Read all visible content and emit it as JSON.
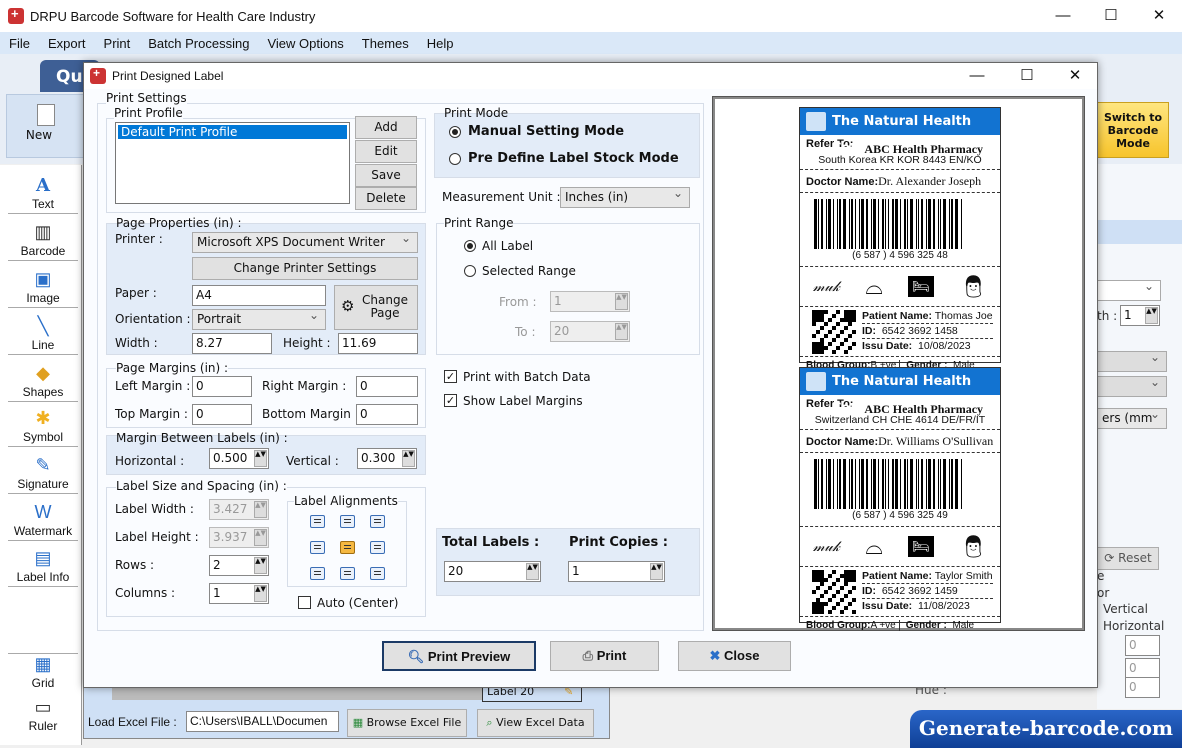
{
  "app": {
    "title": "DRPU Barcode Software for Health Care Industry",
    "window_controls": {
      "minimize": "—",
      "maximize": "☐",
      "close": "✕"
    },
    "menu": [
      "File",
      "Export",
      "Print",
      "Batch Processing",
      "View Options",
      "Themes",
      "Help"
    ],
    "tab": "Qui",
    "new_label": "New",
    "switch_button": "Switch to Barcode Mode",
    "tools": [
      "Text",
      "Barcode",
      "Image",
      "Line",
      "Shapes",
      "Symbol",
      "Signature",
      "Watermark",
      "Label Info"
    ],
    "bottom_tools": [
      "Grid",
      "Ruler"
    ],
    "excel": {
      "label": "Load Excel File :",
      "path": "C:\\Users\\IBALL\\Documen",
      "browse": "Browse Excel File",
      "view": "View Excel Data",
      "label_cell": "Label 20"
    },
    "right_panel": {
      "width_label": "th :",
      "width_value": "1",
      "unit": "ers (mm",
      "reset": "Reset",
      "e": "e",
      "or": "or",
      "vertical": "Vertical",
      "horizontal": "Horizontal",
      "values": [
        "0",
        "0",
        "0"
      ],
      "hue": "Hue :"
    },
    "banner": "Generate-barcode.com"
  },
  "dialog": {
    "title": "Print Designed Label",
    "window_controls": {
      "minimize": "—",
      "maximize": "☐",
      "close": "✕"
    },
    "print_settings": "Print Settings",
    "print_profile": {
      "title": "Print Profile",
      "items": [
        "Default Print Profile"
      ],
      "buttons": [
        "Add",
        "Edit",
        "Save",
        "Delete"
      ]
    },
    "page_properties": {
      "title": "Page Properties (in) :",
      "printer_label": "Printer :",
      "printer": "Microsoft XPS Document Writer",
      "change_printer": "Change Printer Settings",
      "paper_label": "Paper :",
      "paper": "A4",
      "change_page": "Change Page",
      "orientation_label": "Orientation :",
      "orientation": "Portrait",
      "width_label": "Width :",
      "width": "8.27",
      "height_label": "Height :",
      "height": "11.69"
    },
    "page_margins": {
      "title": "Page Margins (in) :",
      "left_label": "Left Margin :",
      "left": "0",
      "right_label": "Right Margin :",
      "right": "0",
      "top_label": "Top Margin :",
      "top": "0",
      "bottom_label": "Bottom Margin :",
      "bottom": "0"
    },
    "margin_between": {
      "title": "Margin Between Labels (in) :",
      "horizontal_label": "Horizontal :",
      "horizontal": "0.500",
      "vertical_label": "Vertical :",
      "vertical": "0.300"
    },
    "label_size": {
      "title": "Label Size and Spacing (in) :",
      "width_label": "Label Width :",
      "width": "3.427",
      "height_label": "Label Height :",
      "height": "3.937",
      "rows_label": "Rows :",
      "rows": "2",
      "columns_label": "Columns :",
      "columns": "1",
      "alignments_title": "Label Alignments",
      "selected_alignment": "middle-center",
      "auto_center": "Auto (Center)",
      "auto_center_checked": false
    },
    "print_mode": {
      "title": "Print Mode",
      "manual": "Manual Setting Mode",
      "predefine": "Pre Define Label Stock Mode",
      "selected": "manual"
    },
    "measurement": {
      "label": "Measurement Unit :",
      "value": "Inches (in)"
    },
    "print_range": {
      "title": "Print Range",
      "all": "All Label",
      "selected_range": "Selected Range",
      "selected": "all",
      "from_label": "From :",
      "from": "1",
      "to_label": "To :",
      "to": "20"
    },
    "batch_data": {
      "label": "Print with Batch Data",
      "checked": true
    },
    "show_margins": {
      "label": "Show Label Margins",
      "checked": true
    },
    "total_labels": {
      "label": "Total Labels :",
      "value": "20"
    },
    "print_copies": {
      "label": "Print Copies :",
      "value": "1"
    },
    "buttons": {
      "preview": "Print Preview",
      "print": "Print",
      "close": "Close"
    }
  },
  "labels": [
    {
      "header": "The Natural Health Care",
      "refer_label": "Refer To:",
      "refer": "ABC Health Pharmacy",
      "address": "South Korea KR KOR 8443 EN/KO",
      "doctor_label": "Doctor Name:",
      "doctor": "Dr. Alexander Joseph",
      "barcode_text": "(6 587 ) 4 596 325 48",
      "patient_label": "Patient Name:",
      "patient": "Thomas Joe",
      "id_label": "ID:",
      "id": "6542 3692 1458",
      "date_label": "Issu Date:",
      "date": "10/08/2023",
      "blood_label": "Blood Group:",
      "blood": "B +ve",
      "gender_label": "Gender :",
      "gender": "Male"
    },
    {
      "header": "The Natural Health Care",
      "refer_label": "Refer To:",
      "refer": "ABC Health Pharmacy",
      "address": "Switzerland CH CHE 4614 DE/FR/IT",
      "doctor_label": "Doctor Name:",
      "doctor": "Dr. Williams O'Sullivan",
      "barcode_text": "(6 587 ) 4 596 325 49",
      "patient_label": "Patient Name:",
      "patient": "Taylor Smith",
      "id_label": "ID:",
      "id": "6542 3692 1459",
      "date_label": "Issu Date:",
      "date": "11/08/2023",
      "blood_label": "Blood Group:",
      "blood": "A +ve",
      "gender_label": "Gender :",
      "gender": "Male"
    }
  ],
  "colors": {
    "accent": "#1273d1",
    "selection": "#0078d7",
    "switch": "#f7c42c",
    "banner": "#0f3f96"
  }
}
